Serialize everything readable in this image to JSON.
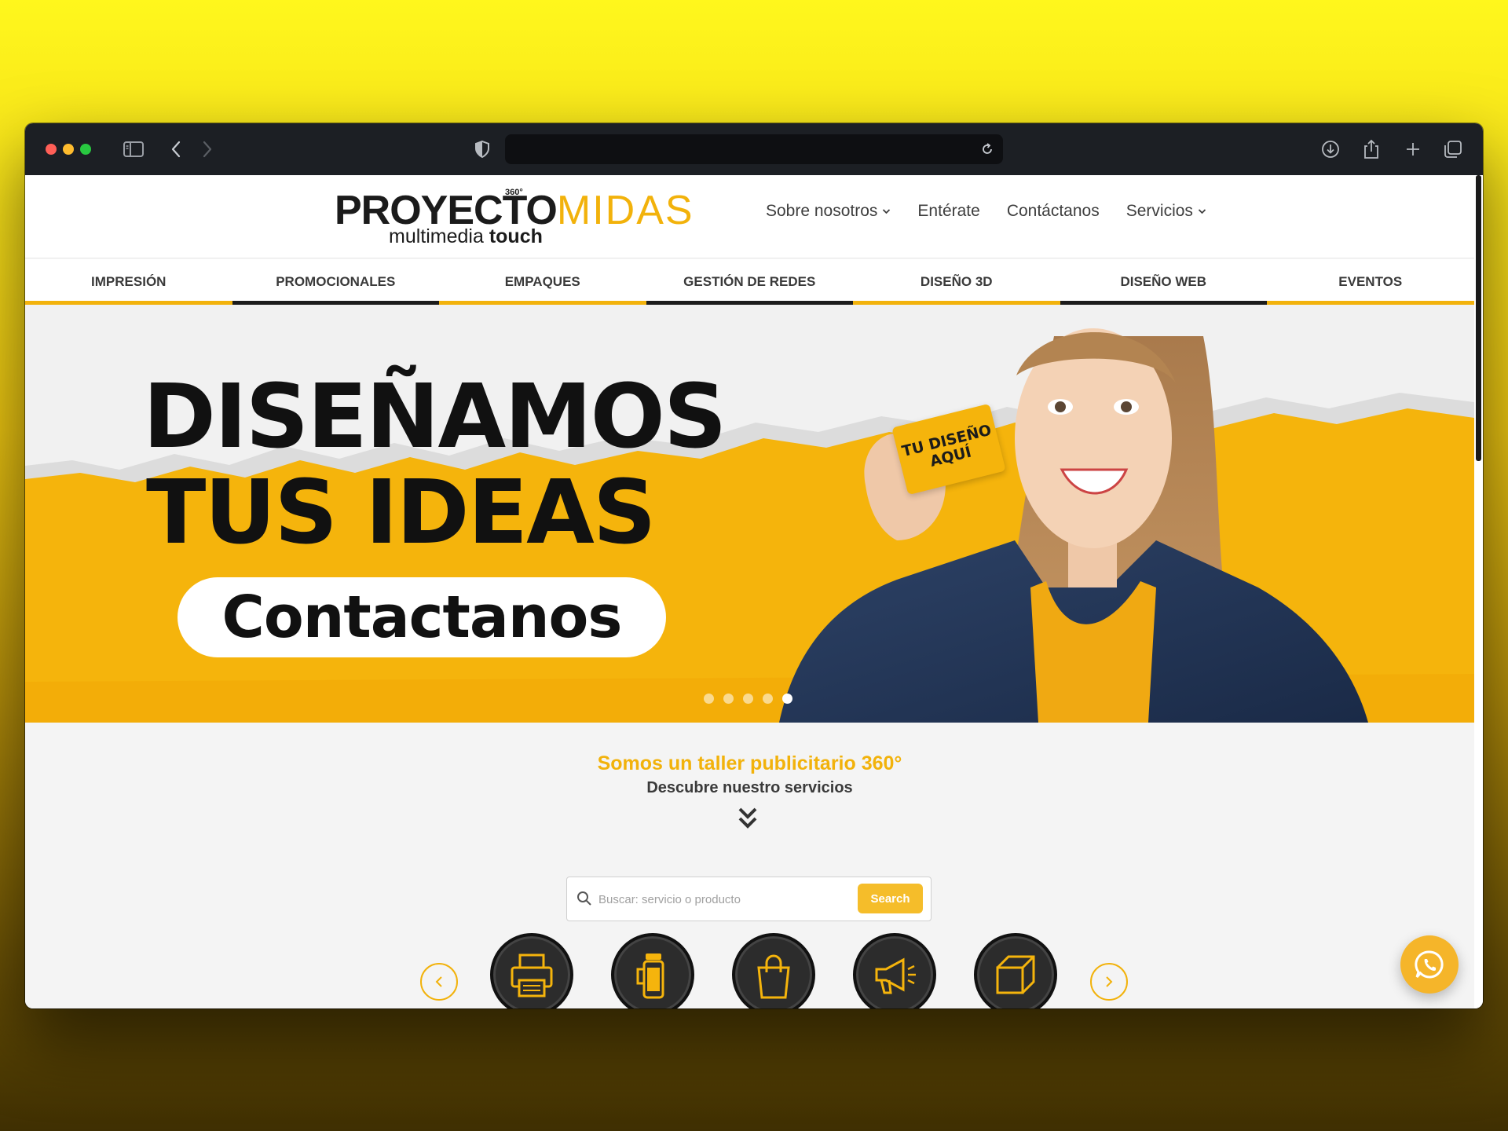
{
  "browser": {
    "url": "",
    "icons": [
      "sidebar-icon",
      "back-icon",
      "forward-icon",
      "shield-icon",
      "reload-icon",
      "download-icon",
      "share-icon",
      "new-tab-icon",
      "tabs-overview-icon"
    ]
  },
  "logo": {
    "part1": "PROYECTO",
    "part2": "MIDAS",
    "badge": "360°",
    "tagline_regular": "multimedia ",
    "tagline_bold": "touch"
  },
  "nav": {
    "items": [
      {
        "label": "Sobre nosotros",
        "dropdown": true
      },
      {
        "label": "Entérate",
        "dropdown": false
      },
      {
        "label": "Contáctanos",
        "dropdown": false
      },
      {
        "label": "Servicios",
        "dropdown": true
      }
    ]
  },
  "categories": [
    {
      "label": "IMPRESIÓN",
      "underline": "gold"
    },
    {
      "label": "PROMOCIONALES",
      "underline": "dark"
    },
    {
      "label": "EMPAQUES",
      "underline": "gold"
    },
    {
      "label": "GESTIÓN DE REDES",
      "underline": "dark"
    },
    {
      "label": "DISEÑO 3D",
      "underline": "gold"
    },
    {
      "label": "DISEÑO WEB",
      "underline": "dark"
    },
    {
      "label": "EVENTOS",
      "underline": "gold"
    }
  ],
  "hero": {
    "line1": "DISEÑAMOS",
    "line2": "TUS IDEAS",
    "cta": "Contactanos",
    "card_line1": "TU DISEÑO",
    "card_line2": "AQUÍ",
    "slide_count": 5,
    "active_slide": 5
  },
  "intro": {
    "tagline": "Somos un taller publicitario 360°",
    "subtitle": "Descubre nuestro servicios"
  },
  "search": {
    "placeholder": "Buscar: servicio o producto",
    "button": "Search"
  },
  "services_carousel": {
    "items": [
      "printer-icon",
      "thermos-icon",
      "shopping-bag-icon",
      "megaphone-icon",
      "cube-icon"
    ]
  },
  "colors": {
    "brand_gold": "#f2b20b",
    "dark": "#1c1c1c",
    "whatsapp_button": "#f5b52a"
  }
}
